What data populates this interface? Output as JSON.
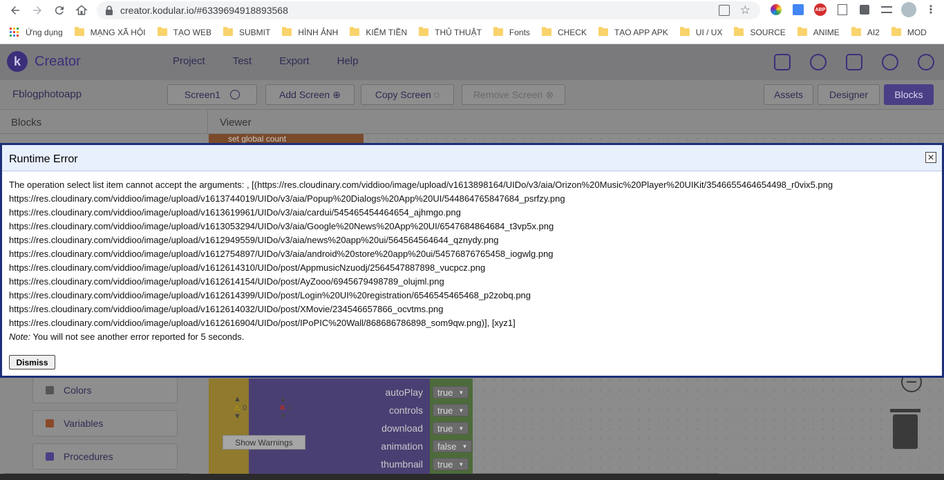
{
  "browser": {
    "url": "creator.kodular.io/#6339694918893568",
    "bookmarks": [
      "Ứng dụng",
      "MẠNG XÃ HỘI",
      "TẠO WEB",
      "SUBMIT",
      "HÌNH ẢNH",
      "KIẾM TIỀN",
      "THỦ THUẬT",
      "Fonts",
      "CHECK",
      "TẠO APP APK",
      "UI / UX",
      "SOURCE",
      "ANIME",
      "AI2",
      "MOD"
    ],
    "extension_icons": [
      "color-picker-icon",
      "translate-icon",
      "adblock-icon",
      "text-icon",
      "puzzle-icon",
      "media-icon",
      "profile-avatar",
      "more-icon"
    ],
    "ext_abp": "ABP"
  },
  "app": {
    "brand": "Creator",
    "logo_letter": "k",
    "menu": [
      "Project",
      "Test",
      "Export",
      "Help"
    ],
    "project_name": "Fblogphotoapp",
    "screen_select": "Screen1",
    "buttons": {
      "add_screen": "Add Screen",
      "copy_screen": "Copy Screen",
      "remove_screen": "Remove Screen",
      "assets": "Assets",
      "designer": "Designer",
      "blocks": "Blocks"
    },
    "panels": {
      "blocks": "Blocks",
      "viewer": "Viewer"
    },
    "block_categories": [
      "Colors",
      "Variables",
      "Procedures"
    ],
    "block_props": [
      {
        "name": "autoPlay",
        "value": "true"
      },
      {
        "name": "controls",
        "value": "true"
      },
      {
        "name": "download",
        "value": "true"
      },
      {
        "name": "animation",
        "value": "false"
      },
      {
        "name": "thumbnail",
        "value": "true"
      }
    ],
    "show_warnings": "Show Warnings",
    "warning_count": "0",
    "error_count": "0",
    "partial_block_text": "set global count"
  },
  "dialog": {
    "title": "Runtime Error",
    "lines": [
      "The operation select list item cannot accept the arguments: , [(https://res.cloudinary.com/viddioo/image/upload/v1613898164/UIDo/v3/aia/Orizon%20Music%20Player%20UIKit/3546655464654498_r0vix5.png",
      "https://res.cloudinary.com/viddioo/image/upload/v1613744019/UIDo/v3/aia/Popup%20Dialogs%20App%20UI/544864765847684_psrfzy.png",
      "https://res.cloudinary.com/viddioo/image/upload/v1613619961/UIDo/v3/aia/cardui/545465454464654_ajhmgo.png",
      "https://res.cloudinary.com/viddioo/image/upload/v1613053294/UIDo/v3/aia/Google%20News%20App%20UI/6547684864684_t3vp5x.png",
      "https://res.cloudinary.com/viddioo/image/upload/v1612949559/UIDo/v3/aia/news%20app%20ui/564564564644_qznydy.png",
      "https://res.cloudinary.com/viddioo/image/upload/v1612754897/UIDo/v3/aia/android%20store%20app%20ui/54576876765458_iogwlg.png",
      "https://res.cloudinary.com/viddioo/image/upload/v1612614310/UIDo/post/AppmusicNzuodj/2564547887898_vucpcz.png",
      "https://res.cloudinary.com/viddioo/image/upload/v1612614154/UIDo/post/AyZooo/6945679498789_olujml.png",
      "https://res.cloudinary.com/viddioo/image/upload/v1612614399/UIDo/post/Login%20UI%20registration/6546545465468_p2zobq.png",
      "https://res.cloudinary.com/viddioo/image/upload/v1612614032/UIDo/post/XMovie/234546657866_ocvtms.png",
      "https://res.cloudinary.com/viddioo/image/upload/v1612616904/UIDo/post/IPoPIC%20Wall/868686786898_som9qw.png)], [xyz1]"
    ],
    "note_label": "Note:",
    "note_text": " You will not see another error reported for 5 seconds.",
    "dismiss": "Dismiss",
    "close_glyph": "✕"
  },
  "colors": {
    "brand_purple": "#3b2e7a",
    "dialog_border": "#1c2f78",
    "dialog_header": "#e8f0fe",
    "active_tab": "#4a3f86"
  }
}
